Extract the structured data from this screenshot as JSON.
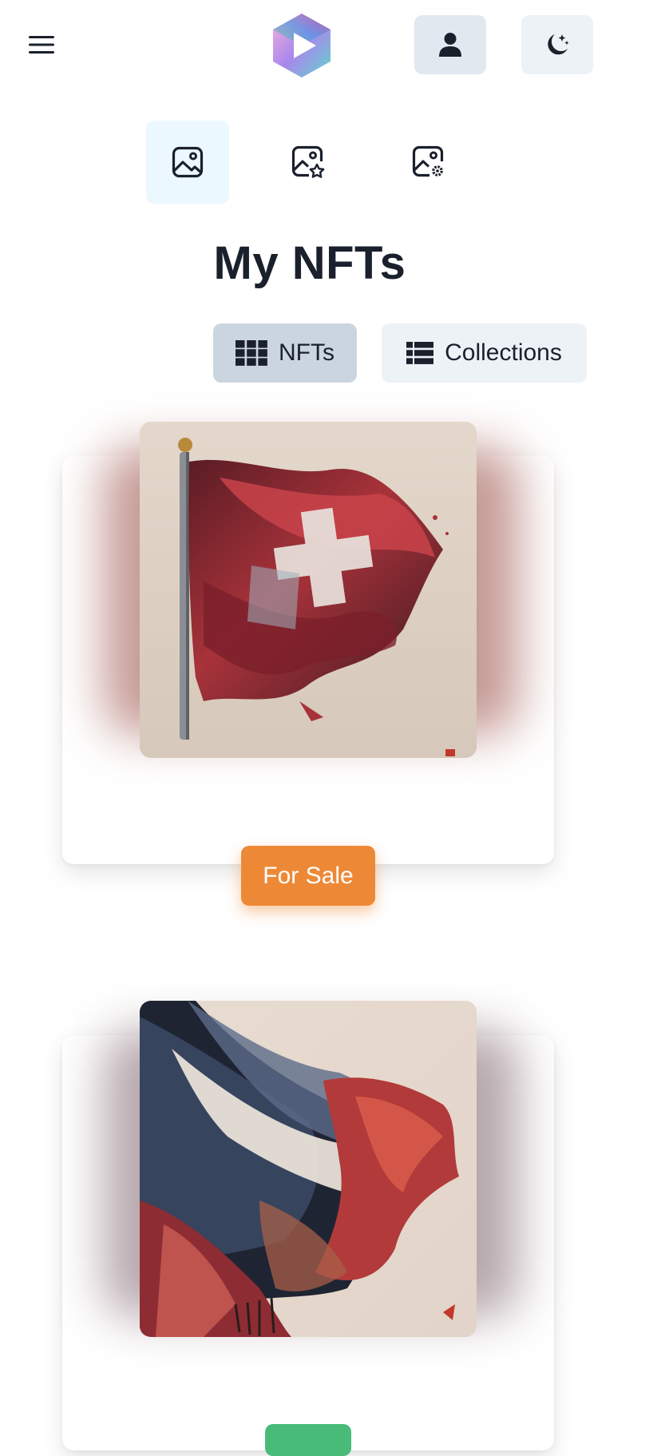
{
  "header": {
    "menu_icon": "hamburger-icon",
    "logo_icon": "play-cube-logo",
    "user_icon": "user-icon",
    "theme_icon": "moon-stars-icon"
  },
  "icon_tabs": [
    {
      "icon": "image-icon",
      "active": true
    },
    {
      "icon": "image-star-icon",
      "active": false
    },
    {
      "icon": "image-gear-icon",
      "active": false
    }
  ],
  "page": {
    "title": "My NFTs"
  },
  "view_toggle": {
    "nfts_label": "NFTs",
    "collections_label": "Collections",
    "selected": "NFTs"
  },
  "cards": [
    {
      "artwork": "swiss-flag-painting",
      "button_label": "For Sale",
      "button_color": "#ed8936"
    },
    {
      "artwork": "waving-flag-painting",
      "button_color": "#48bb78"
    }
  ],
  "colors": {
    "accent_orange": "#ed8936",
    "accent_green": "#48bb78",
    "button_gray": "#e2e8f0",
    "selected_gray": "#cbd5e0"
  }
}
